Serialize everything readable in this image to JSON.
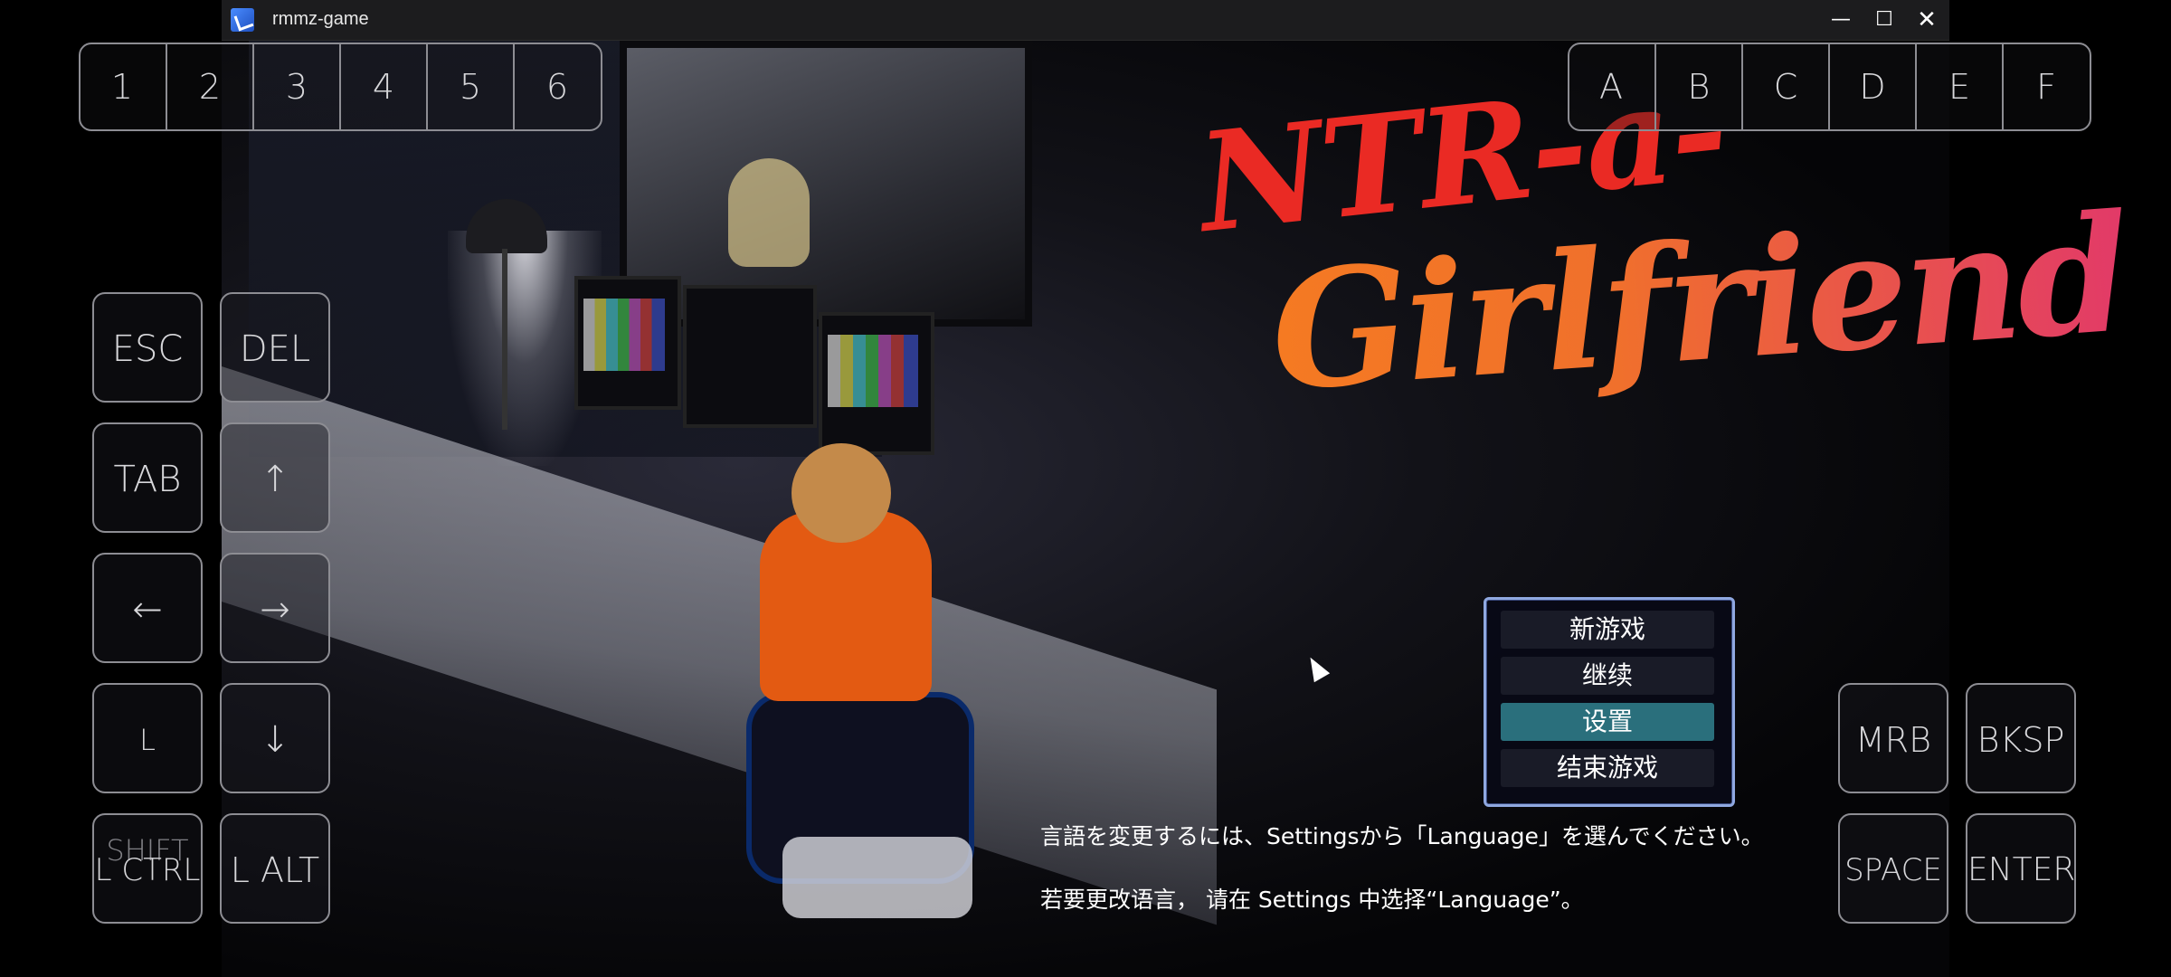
{
  "window": {
    "title": "rmmz-game",
    "minimize_glyph": "—",
    "maximize_glyph": "☐",
    "close_glyph": "✕"
  },
  "game": {
    "logo_line_1": "NTR-a-",
    "logo_line_2": "Girlfriend",
    "menu": {
      "items": [
        "新游戏",
        "继续",
        "设置",
        "结束游戏"
      ],
      "selected_index": 2
    },
    "hint_japanese": "言語を変更するには、Settingsから「Language」を選んでください。",
    "hint_chinese": "若要更改语言， 请在 Settings 中选择“Language”。"
  },
  "virtual_keys": {
    "number_row": [
      "1",
      "2",
      "3",
      "4",
      "5",
      "6"
    ],
    "letter_row": [
      "A",
      "B",
      "C",
      "D",
      "E",
      "F"
    ],
    "left_pad": {
      "esc": "ESC",
      "del": "DEL",
      "tab": "TAB",
      "up": "↑",
      "left": "←",
      "right": "→",
      "lshift": "L SHIFT",
      "down": "↓",
      "lctrl": "L CTRL",
      "lalt": "L ALT"
    },
    "right_pad": {
      "mrb": "MRB",
      "bksp": "BKSP",
      "space": "SPACE",
      "enter": "ENTER"
    }
  },
  "colors": {
    "menu_border": "#8fa8e0",
    "menu_selected": "#2a6f7c",
    "logo_red": "#ea2a24",
    "logo_orange": "#f57a22",
    "logo_pink": "#e23a68"
  }
}
